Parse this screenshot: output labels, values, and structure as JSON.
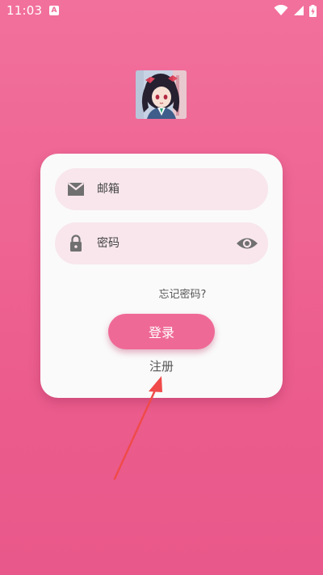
{
  "status_bar": {
    "time": "11:03",
    "a_badge": "A",
    "icons": [
      "wifi-icon",
      "signal-icon",
      "battery-charging-icon"
    ]
  },
  "avatar": {
    "icon": "avatar-anime-girl"
  },
  "login_form": {
    "email_placeholder": "邮箱",
    "password_placeholder": "密码",
    "forgot_password": "忘记密码?",
    "login_button": "登录",
    "register_link": "注册"
  },
  "colors": {
    "background": "#ef6996",
    "card": "#fafafa",
    "field": "#f8e6ec",
    "button": "#ef6996",
    "arrow": "#f04a4a"
  }
}
